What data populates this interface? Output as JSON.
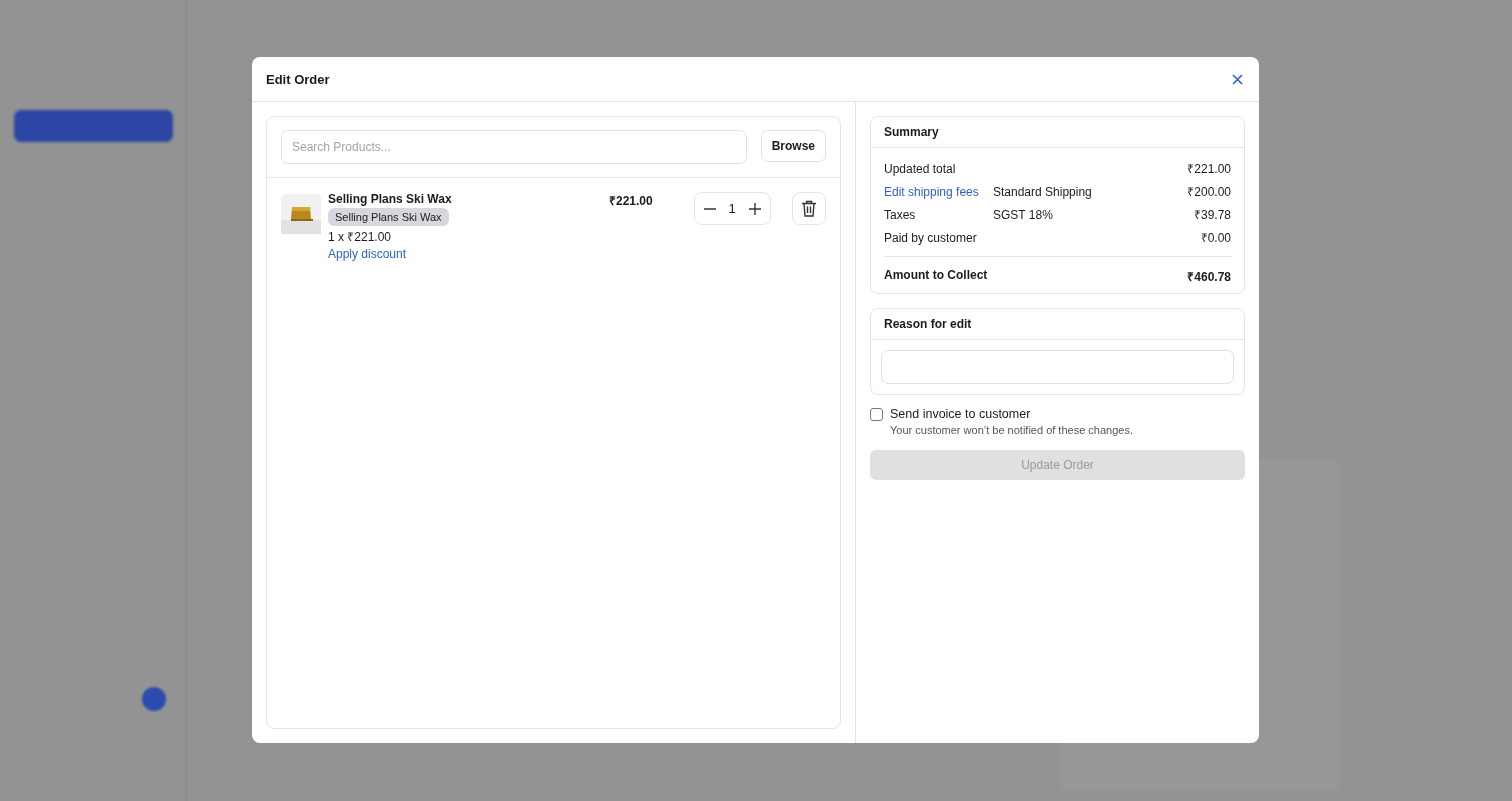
{
  "dialog": {
    "title": "Edit Order"
  },
  "search": {
    "placeholder": "Search Products..."
  },
  "browse_button": "Browse",
  "line_items": [
    {
      "name": "Selling Plans Ski Wax",
      "variant": "Selling Plans Ski Wax",
      "unit_price": "1 x ₹221.00",
      "discount_link": "Apply discount",
      "total": "₹221.00",
      "quantity": "1"
    }
  ],
  "summary": {
    "title": "Summary",
    "rows": [
      {
        "label": "Updated total",
        "kind": "plain",
        "value": "₹221.00"
      },
      {
        "label": "Edit shipping fees",
        "kind": "link",
        "detail": "Standard Shipping",
        "value": "₹200.00"
      },
      {
        "label": "Taxes",
        "kind": "plain",
        "detail": "SGST 18%",
        "value": "₹39.78"
      },
      {
        "label": "Paid by customer",
        "kind": "plain",
        "value": "₹0.00"
      }
    ],
    "total": {
      "label": "Amount to Collect",
      "value": "₹460.78"
    }
  },
  "reason": {
    "title": "Reason for edit"
  },
  "send_invoice": {
    "label": "Send invoice to customer",
    "checked": false,
    "note": "Your customer won’t be notified of these changes."
  },
  "update_button": {
    "label": "Update Order",
    "disabled": true
  }
}
